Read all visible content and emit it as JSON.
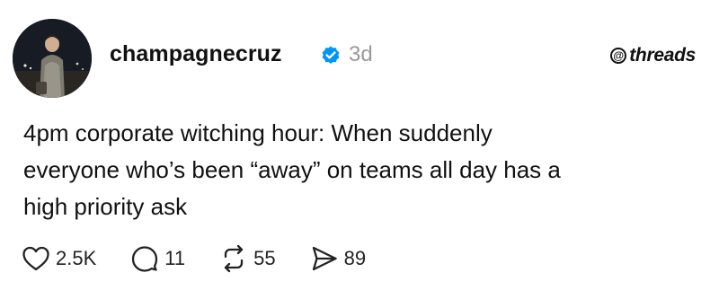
{
  "post": {
    "username": "champagnecruz",
    "verified": true,
    "time_ago": "3d",
    "brand": "threads",
    "text": "4pm corporate witching hour: When suddenly\neveryone who’s been “away” on teams all day has a\nhigh priority ask",
    "stats": {
      "likes": "2.5K",
      "replies": "11",
      "reposts": "55",
      "shares": "89"
    }
  },
  "colors": {
    "verified_badge": "#0095f6",
    "muted_text": "#9a9a9a",
    "text": "#111111"
  }
}
